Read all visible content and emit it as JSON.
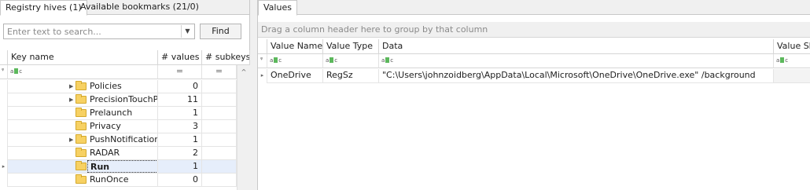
{
  "left": {
    "tabs": [
      {
        "label": "Registry hives (1)",
        "active": true
      },
      {
        "label": "Available bookmarks (21/0)",
        "active": false
      }
    ],
    "search": {
      "placeholder": "Enter text to search...",
      "value": "",
      "find_label": "Find"
    },
    "columns": {
      "key_name": "Key name",
      "values": "# values",
      "subkeys": "# subkeys"
    },
    "filter": {
      "text_icon": "text-filter-icon",
      "eq_symbol": "="
    },
    "rows": [
      {
        "name": "Policies",
        "values": "0",
        "expandable": true,
        "selected": false
      },
      {
        "name": "PrecisionTouchPad",
        "values": "11",
        "expandable": true,
        "selected": false
      },
      {
        "name": "Prelaunch",
        "values": "1",
        "expandable": false,
        "selected": false
      },
      {
        "name": "Privacy",
        "values": "3",
        "expandable": false,
        "selected": false
      },
      {
        "name": "PushNotifications",
        "values": "1",
        "expandable": true,
        "selected": false
      },
      {
        "name": "RADAR",
        "values": "2",
        "expandable": false,
        "selected": false
      },
      {
        "name": "Run",
        "values": "1",
        "expandable": false,
        "selected": true
      },
      {
        "name": "RunOnce",
        "values": "0",
        "expandable": false,
        "selected": false
      }
    ]
  },
  "right": {
    "tabs": [
      {
        "label": "Values",
        "active": true
      }
    ],
    "group_by_hint": "Drag a column header here to group by that column",
    "columns": {
      "value_name": "Value Name",
      "value_type": "Value Type",
      "data": "Data",
      "value_slack": "Value Sla"
    },
    "rows": [
      {
        "value_name": "OneDrive",
        "value_type": "RegSz",
        "data": "\"C:\\Users\\johnzoidberg\\AppData\\Local\\Microsoft\\OneDrive\\OneDrive.exe\" /background",
        "value_slack": ""
      }
    ]
  },
  "colors": {
    "selection": "#e6eefb",
    "folder": "#f7d163",
    "chrome": "#f0f0f0"
  }
}
